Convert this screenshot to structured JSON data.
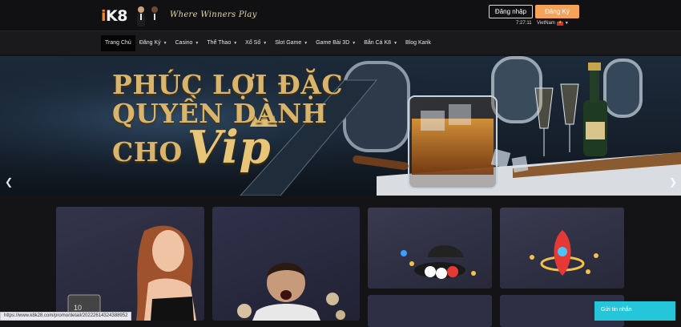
{
  "header": {
    "logo_text": "K8",
    "slogan": "Where Winners Play",
    "login_label": "Đăng nhập",
    "register_label": "Đăng Ký",
    "clock": "7:27:11",
    "language": "VietNam"
  },
  "nav": {
    "items": [
      {
        "label": "Trang Chủ",
        "dropdown": false,
        "active": true
      },
      {
        "label": "Đăng Ký",
        "dropdown": true
      },
      {
        "label": "Casino",
        "dropdown": true
      },
      {
        "label": "Thể Thao",
        "dropdown": true
      },
      {
        "label": "Xổ Số",
        "dropdown": true
      },
      {
        "label": "Slot Game",
        "dropdown": true
      },
      {
        "label": "Game Bài 3D",
        "dropdown": true
      },
      {
        "label": "Bắn Cá K8",
        "dropdown": true
      },
      {
        "label": "Blog Karik",
        "dropdown": false
      }
    ]
  },
  "banner": {
    "line1": "PHÚC LỢI ĐẶC",
    "line2": "QUYỀN DÀNH",
    "line3_prefix": "CHO",
    "line3_script": "Vip",
    "prev_icon": "chevron-left-icon",
    "next_icon": "chevron-right-icon"
  },
  "statusbar": {
    "url": "https://www.k8k28.com/promo/detail/20222614324388952"
  },
  "chat": {
    "label": "Gửi tin nhắn"
  },
  "colors": {
    "accent_orange": "#f5a25a",
    "gold": "#d9b46c",
    "chat_cyan": "#26c6da",
    "background": "#141416"
  }
}
